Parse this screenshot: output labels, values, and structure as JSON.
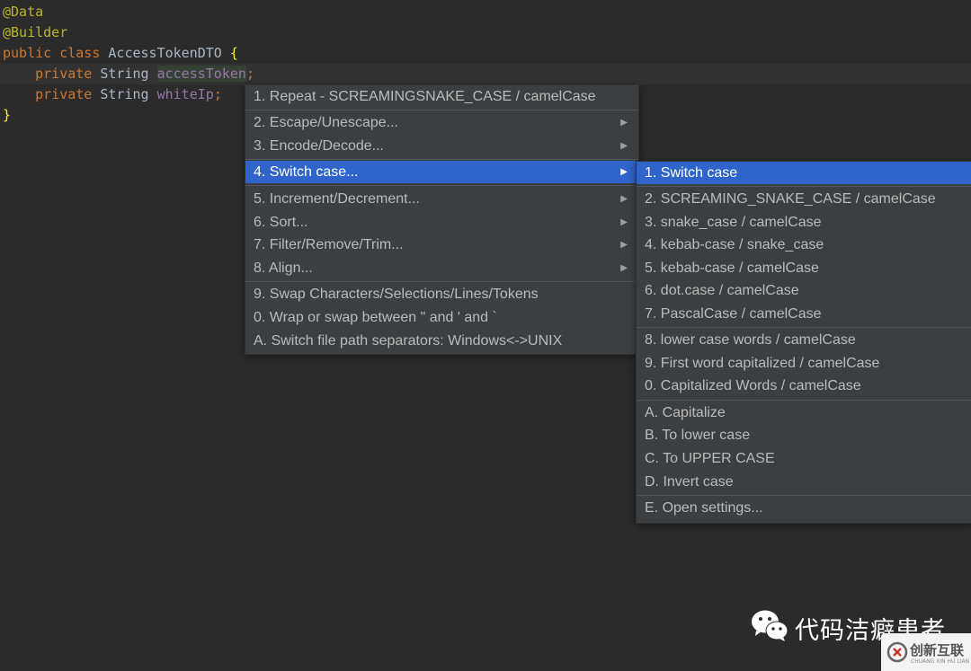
{
  "editor": {
    "line1": {
      "annotation": "@Data"
    },
    "line2": {
      "annotation": "@Builder"
    },
    "line3": {
      "kw_public": "public",
      "kw_class": "class",
      "class_name": "AccessTokenDTO",
      "open_brace": "{"
    },
    "line4": {
      "kw_private": "private",
      "type": "String",
      "field": "accessToken",
      "semicolon": ";"
    },
    "line5": {
      "kw_private": "private",
      "type": "String",
      "field": "whiteIp",
      "semicolon": ";"
    },
    "line6": {
      "close_brace": "}"
    }
  },
  "main_menu": {
    "items": [
      {
        "label": "1. Repeat - SCREAMINGSNAKE_CASE / camelCase",
        "submenu": false
      },
      {
        "label": "2. Escape/Unescape...",
        "submenu": true
      },
      {
        "label": "3. Encode/Decode...",
        "submenu": true
      },
      {
        "label": "4. Switch case...",
        "submenu": true,
        "selected": true
      },
      {
        "label": "5. Increment/Decrement...",
        "submenu": true
      },
      {
        "label": "6. Sort...",
        "submenu": true
      },
      {
        "label": "7. Filter/Remove/Trim...",
        "submenu": true
      },
      {
        "label": "8. Align...",
        "submenu": true
      },
      {
        "label": "9. Swap Characters/Selections/Lines/Tokens",
        "submenu": false
      },
      {
        "label": "0. Wrap or swap between \" and ' and `",
        "submenu": false
      },
      {
        "label": "A. Switch file path separators: Windows<->UNIX",
        "submenu": false
      }
    ],
    "arrow_glyph": "▶"
  },
  "sub_menu": {
    "items": [
      {
        "label": "1. Switch case",
        "selected": true
      },
      {
        "label": "2. SCREAMING_SNAKE_CASE / camelCase"
      },
      {
        "label": "3. snake_case / camelCase"
      },
      {
        "label": "4. kebab-case / snake_case"
      },
      {
        "label": "5. kebab-case / camelCase"
      },
      {
        "label": "6. dot.case / camelCase"
      },
      {
        "label": "7. PascalCase / camelCase"
      },
      {
        "label": "8. lower case words / camelCase"
      },
      {
        "label": "9. First word capitalized / camelCase"
      },
      {
        "label": "0. Capitalized Words / camelCase"
      },
      {
        "label": "A. Capitalize"
      },
      {
        "label": "B. To lower case"
      },
      {
        "label": "C. To UPPER CASE"
      },
      {
        "label": "D. Invert case"
      },
      {
        "label": "E. Open settings..."
      }
    ]
  },
  "watermark": {
    "text": "代码洁癖患者",
    "badge_text": "创新互联",
    "badge_sub": "CHUANG XIN HU LIAN",
    "icon": "wechat-icon"
  },
  "colors": {
    "editor_bg": "#2b2b2b",
    "menu_bg": "#3c3f41",
    "selection": "#2f65ca",
    "keyword": "#cc7832",
    "annotation": "#bbb529",
    "field": "#9876aa"
  }
}
